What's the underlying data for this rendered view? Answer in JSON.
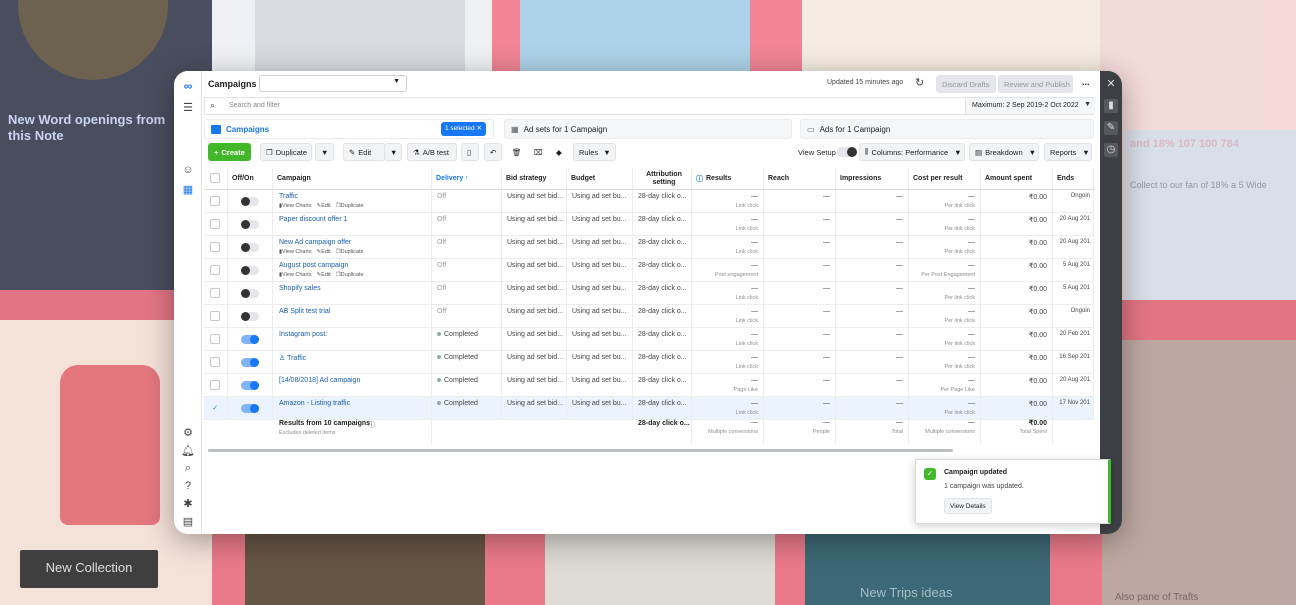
{
  "topbar": {
    "title": "Campaigns",
    "updated": "Updated 15 minutes ago",
    "discard": "Discard Drafts",
    "review": "Review and Publish",
    "more": "..."
  },
  "search": {
    "placeholder": "Search and filter",
    "daterange": "Maximum: 2 Sep 2019-2 Oct 2022"
  },
  "tabs": {
    "campaigns": "Campaigns",
    "selected": "1 selected",
    "adsets": "Ad sets for 1 Campaign",
    "ads": "Ads for 1 Campaign"
  },
  "toolbar": {
    "create": "Create",
    "duplicate": "Duplicate",
    "edit": "Edit",
    "abtest": "A/B test",
    "rules": "Rules",
    "view_setup": "View Setup",
    "columns": "Columns: Performance",
    "breakdown": "Breakdown",
    "reports": "Reports"
  },
  "columns": {
    "offon": "Off/On",
    "campaign": "Campaign",
    "delivery": "Delivery ↑",
    "bid": "Bid strategy",
    "budget": "Budget",
    "attribution": "Attribution setting",
    "results": "Results",
    "reach": "Reach",
    "impressions": "Impressions",
    "cpr": "Cost per result",
    "spent": "Amount spent",
    "ends": "Ends"
  },
  "actions": {
    "charts": "View Charts",
    "edit": "Edit",
    "duplicate": "Duplicate"
  },
  "rows": [
    {
      "name": "Traffic",
      "on": false,
      "delivery": "Off",
      "bid": "Using ad set bid...",
      "budget": "Using ad set bu...",
      "attr": "28-day click o...",
      "results": "—",
      "results_sub": "Link click",
      "reach": "—",
      "impr": "—",
      "cpr": "—",
      "cpr_sub": "Per link click",
      "spent": "₹0.00",
      "ends": "Ongoin",
      "actions": true,
      "selected": false
    },
    {
      "name": "Paper discount offer 1",
      "on": false,
      "delivery": "Off",
      "bid": "Using ad set bid...",
      "budget": "Using ad set bu...",
      "attr": "28-day click o...",
      "results": "—",
      "results_sub": "Link click",
      "reach": "—",
      "impr": "—",
      "cpr": "—",
      "cpr_sub": "Per link click",
      "spent": "₹0.00",
      "ends": "20 Aug 201",
      "actions": false,
      "selected": false
    },
    {
      "name": "New Ad campaign offer",
      "on": false,
      "delivery": "Off",
      "bid": "Using ad set bid...",
      "budget": "Using ad set bu...",
      "attr": "28-day click o...",
      "results": "—",
      "results_sub": "Link click",
      "reach": "—",
      "impr": "—",
      "cpr": "—",
      "cpr_sub": "Per link click",
      "spent": "₹0.00",
      "ends": "20 Aug 201",
      "actions": true,
      "selected": false
    },
    {
      "name": "August post campaign",
      "on": false,
      "delivery": "Off",
      "bid": "Using ad set bid...",
      "budget": "Using ad set bu...",
      "attr": "28-day click o...",
      "results": "—",
      "results_sub": "Post engagement",
      "reach": "—",
      "impr": "—",
      "cpr": "—",
      "cpr_sub": "Per Post Engagement",
      "spent": "₹0.00",
      "ends": "5 Aug 201",
      "actions": true,
      "selected": false
    },
    {
      "name": "Shopify sales",
      "on": false,
      "delivery": "Off",
      "bid": "Using ad set bid...",
      "budget": "Using ad set bu...",
      "attr": "28-day click o...",
      "results": "—",
      "results_sub": "Link click",
      "reach": "—",
      "impr": "—",
      "cpr": "—",
      "cpr_sub": "Per link click",
      "spent": "₹0.00",
      "ends": "5 Aug 201",
      "actions": false,
      "selected": false
    },
    {
      "name": "AB Split test trial",
      "on": false,
      "delivery": "Off",
      "bid": "Using ad set bid...",
      "budget": "Using ad set bu...",
      "attr": "28-day click o...",
      "results": "—",
      "results_sub": "Link click",
      "reach": "—",
      "impr": "—",
      "cpr": "—",
      "cpr_sub": "Per link click",
      "spent": "₹0.00",
      "ends": "Ongoin",
      "actions": false,
      "selected": false
    },
    {
      "name": "Instagram post:",
      "on": true,
      "delivery": "Completed",
      "bid": "Using ad set bid...",
      "budget": "Using ad set bu...",
      "attr": "28-day click o...",
      "results": "—",
      "results_sub": "Link click",
      "reach": "—",
      "impr": "—",
      "cpr": "—",
      "cpr_sub": "Per link click",
      "spent": "₹0.00",
      "ends": "20 Feb 201",
      "actions": false,
      "selected": false
    },
    {
      "name": "♙ Traffic",
      "on": true,
      "delivery": "Completed",
      "bid": "Using ad set bid...",
      "budget": "Using ad set bu...",
      "attr": "28-day click o...",
      "results": "—",
      "results_sub": "Link click",
      "reach": "—",
      "impr": "—",
      "cpr": "—",
      "cpr_sub": "Per link click",
      "spent": "₹0.00",
      "ends": "16 Sep 201",
      "actions": false,
      "selected": false
    },
    {
      "name": "[14/08/2018] Ad campaign",
      "on": true,
      "delivery": "Completed",
      "bid": "Using ad set bid...",
      "budget": "Using ad set bu...",
      "attr": "28-day click o...",
      "results": "—",
      "results_sub": "Page Like",
      "reach": "—",
      "impr": "—",
      "cpr": "—",
      "cpr_sub": "Per Page Like",
      "spent": "₹0.00",
      "ends": "20 Aug 201",
      "actions": false,
      "selected": false
    },
    {
      "name": "Amazon - Listing traffic",
      "on": true,
      "delivery": "Completed",
      "bid": "Using ad set bid...",
      "budget": "Using ad set bu...",
      "attr": "28-day click o...",
      "results": "—",
      "results_sub": "Link click",
      "reach": "—",
      "impr": "—",
      "cpr": "—",
      "cpr_sub": "Per link click",
      "spent": "₹0.00",
      "ends": "17 Nov 201",
      "actions": false,
      "selected": true
    }
  ],
  "totals": {
    "label": "Results from 10 campaigns",
    "excludes": "Excludes deleted items",
    "attr": "28-day click o...",
    "results": "—",
    "results_sub": "Multiple conversions",
    "reach": "—",
    "reach_sub": "People",
    "impr": "—",
    "impr_sub": "Total",
    "cpr": "—",
    "cpr_sub": "Multiple conversions",
    "spent": "₹0.00",
    "spent_sub": "Total Spent"
  },
  "toast": {
    "title": "Campaign updated",
    "body": "1 campaign was updated.",
    "button": "View Details"
  },
  "background": {
    "left_title": "New Word openings from this Note",
    "left_button": "New Collection",
    "right_title": "and 18% 107 100 784",
    "right_sub": "Collect to our fan of 18% a 5 Wide",
    "bottom_center": "New Trips ideas",
    "bottom_right": "Also pane of Trafts"
  },
  "colors": {
    "accent": "#1877f2",
    "create": "#42b72a",
    "rightbar": "#3c3f44"
  }
}
